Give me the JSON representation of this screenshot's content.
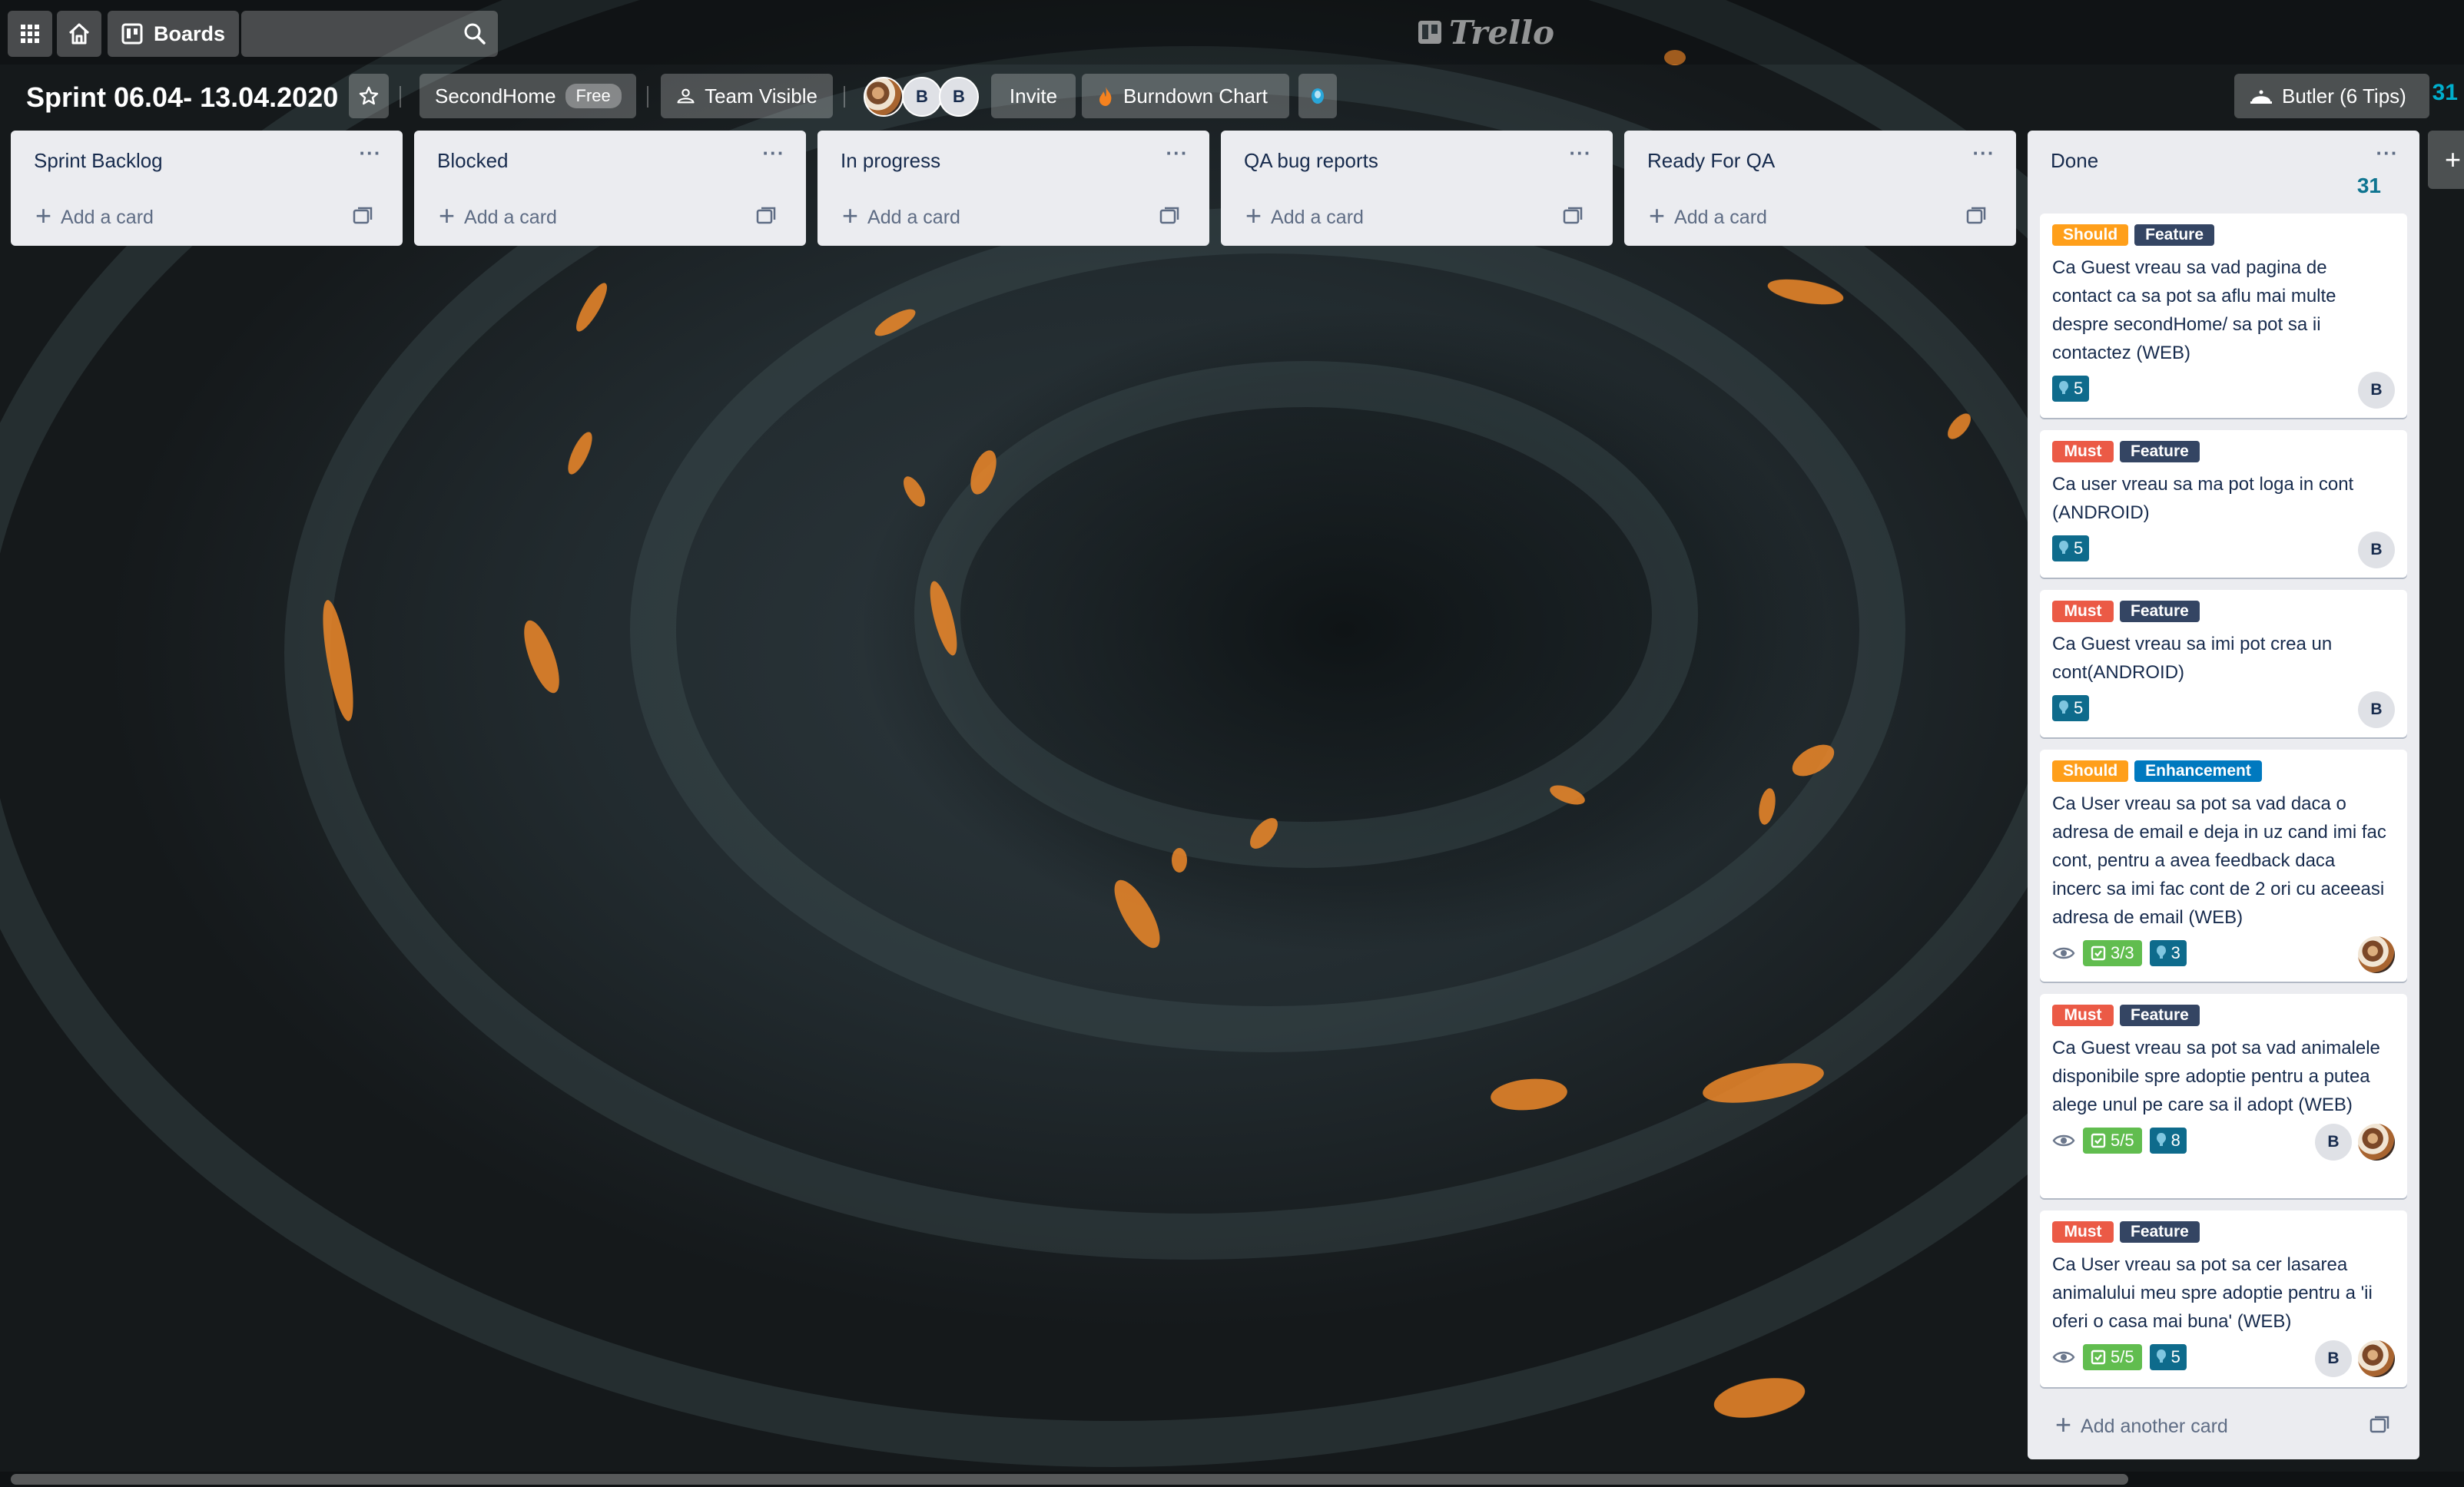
{
  "header": {
    "boards_label": "Boards",
    "search_placeholder": "",
    "logo_text": "Trello"
  },
  "board": {
    "title": "Sprint 06.04- 13.04.2020",
    "team_name": "SecondHome",
    "team_badge": "Free",
    "visibility_label": "Team Visible",
    "members": [
      "B",
      "B"
    ],
    "invite_label": "Invite",
    "burndown_label": "Burndown Chart",
    "butler_label": "Butler (6 Tips)",
    "right_count": "31"
  },
  "lists": [
    {
      "title": "Sprint Backlog",
      "add_label": "Add a card"
    },
    {
      "title": "Blocked",
      "add_label": "Add a card"
    },
    {
      "title": "In progress",
      "add_label": "Add a card"
    },
    {
      "title": "QA bug reports",
      "add_label": "Add a card"
    },
    {
      "title": "Ready For QA",
      "add_label": "Add a card"
    }
  ],
  "done": {
    "title": "Done",
    "count": "31",
    "add_another_label": "Add another card",
    "cards": [
      {
        "labels": [
          "Should",
          "Feature"
        ],
        "text": "Ca Guest vreau sa vad pagina de contact ca sa pot sa aflu mai multe despre secondHome/ sa pot sa ii contactez (WEB)",
        "points": "5",
        "members": [
          "B"
        ]
      },
      {
        "labels": [
          "Must",
          "Feature"
        ],
        "text": "Ca user vreau sa ma pot loga in cont (ANDROID)",
        "points": "5",
        "members": [
          "B"
        ]
      },
      {
        "labels": [
          "Must",
          "Feature"
        ],
        "text": "Ca Guest vreau sa imi pot crea un cont(ANDROID)",
        "points": "5",
        "members": [
          "B"
        ]
      },
      {
        "labels": [
          "Should",
          "Enhancement"
        ],
        "text": "Ca User vreau sa pot sa vad daca o adresa de email e deja in uz cand imi fac cont, pentru a avea feedback daca incerc sa imi fac cont de 2 ori cu aceeasi adresa de email (WEB)",
        "checklist": "3/3",
        "points": "3",
        "members": [
          "photo"
        ]
      },
      {
        "labels": [
          "Must",
          "Feature"
        ],
        "text": "Ca Guest vreau sa pot sa vad animalele disponibile spre adoptie pentru a putea alege unul pe care sa il adopt (WEB)",
        "checklist": "5/5",
        "points": "8",
        "members": [
          "B",
          "photo"
        ]
      },
      {
        "labels": [
          "Must",
          "Feature"
        ],
        "text": "Ca User vreau sa pot sa cer lasarea animalului meu spre adoptie pentru a 'ii oferi o casa mai buna' (WEB)",
        "checklist": "5/5",
        "points": "5",
        "members": [
          "B",
          "photo"
        ]
      }
    ]
  },
  "colors": {
    "label_should": "#ff9f1a",
    "label_must": "#eb5a46",
    "label_feature": "#344563",
    "label_enhancement": "#0079bf",
    "checklist_complete": "#61bd4f",
    "points_badge": "#0e6b8c",
    "list_bg": "#ebecf0"
  }
}
